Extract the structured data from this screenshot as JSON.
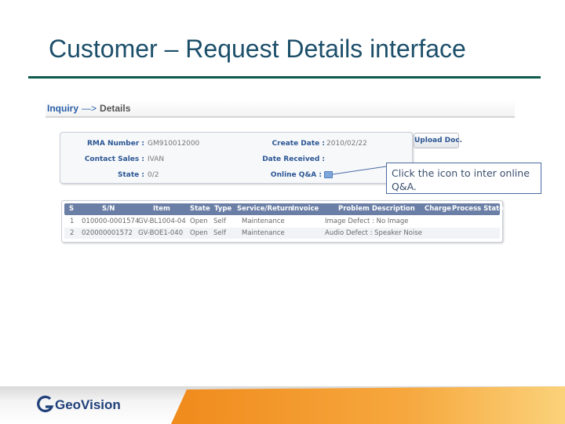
{
  "slide": {
    "title": "Customer – Request Details interface"
  },
  "breadcrumb": {
    "inquiry": "Inquiry",
    "separator": "—>",
    "details": "Details"
  },
  "info": {
    "rma_number_label": "RMA Number :",
    "rma_number_value": "GM910012000",
    "contact_sales_label": "Contact Sales :",
    "contact_sales_value": "IVAN",
    "state_label": "State :",
    "state_value": "0/2",
    "create_date_label": "Create Date :",
    "create_date_value": "2010/02/22",
    "date_received_label": "Date Received :",
    "date_received_value": "",
    "online_qa_label": "Online Q&A :",
    "upload_button": "Upload Doc."
  },
  "callout": {
    "text": "Click the icon to inter online Q&A."
  },
  "table": {
    "headers": [
      "S",
      "S/N",
      "Item",
      "State",
      "Type",
      "Service/Return",
      "Invoice",
      "Problem Description",
      "Charge",
      "Process State"
    ],
    "rows": [
      [
        "1",
        "010000-0001574",
        "GV-BL1004-04",
        "Open",
        "Self",
        "Maintenance",
        "",
        "Image Defect : No Image",
        "",
        ""
      ],
      [
        "2",
        "020000001572",
        "GV-BOE1-040",
        "Open",
        "Self",
        "Maintenance",
        "",
        "Audio Defect : Speaker Noise",
        "",
        ""
      ]
    ]
  },
  "footer": {
    "brand": "GeoVision",
    "accent_color": "#f4a23a"
  }
}
